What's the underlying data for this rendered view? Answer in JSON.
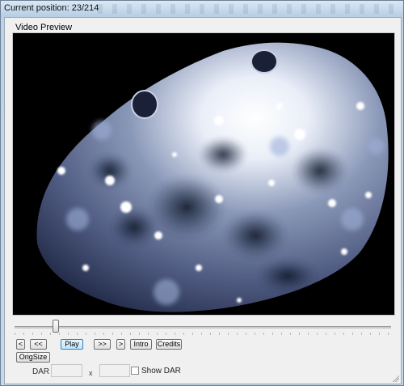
{
  "window": {
    "title": "Current position: 23/214"
  },
  "preview": {
    "group_label": "Video Preview",
    "image_description": "asteroid surface video frame"
  },
  "seek": {
    "position": 23,
    "total": 214
  },
  "controls": {
    "prev_frame": "<",
    "rewind": "<<",
    "play": "Play",
    "fast_forward": ">>",
    "next_frame": ">",
    "intro": "Intro",
    "credits": "Credits",
    "orig_size": "OrigSize"
  },
  "dar": {
    "label": "DAR",
    "width_value": "",
    "separator": "x",
    "height_value": "",
    "show_dar_label": "Show DAR",
    "show_dar_checked": false
  },
  "colors": {
    "frame_bg": "#000000",
    "asteroid_light": "#ffffff",
    "asteroid_mid": "#8a98b8",
    "asteroid_dark": "#1c2440"
  }
}
